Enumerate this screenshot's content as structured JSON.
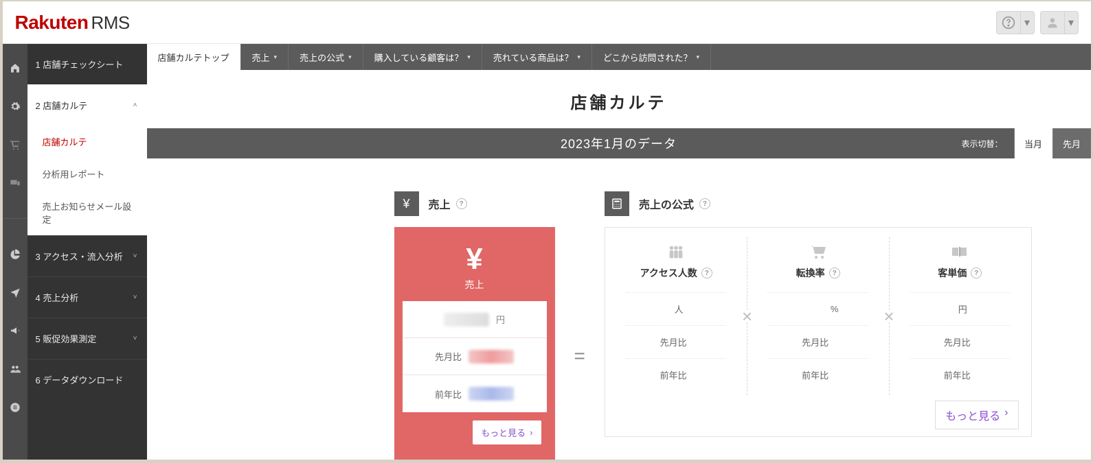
{
  "brand": {
    "name": "Rakuten",
    "suffix": "RMS"
  },
  "topbar": {
    "help": "help-icon",
    "user": "user-icon"
  },
  "rail_icons": [
    "home",
    "gear",
    "cart",
    "devices",
    "pie",
    "plane",
    "megaphone",
    "people",
    "list"
  ],
  "sidebar": {
    "items": [
      {
        "label": "1 店舗チェックシート",
        "expandable": false
      },
      {
        "label": "2 店舗カルテ",
        "expandable": true,
        "active": true,
        "children": [
          {
            "label": "店舗カルテ",
            "selected": true
          },
          {
            "label": "分析用レポート"
          },
          {
            "label": "売上お知らせメール設定"
          }
        ]
      },
      {
        "label": "3 アクセス・流入分析",
        "expandable": true
      },
      {
        "label": "4 売上分析",
        "expandable": true
      },
      {
        "label": "5 販促効果測定",
        "expandable": true
      },
      {
        "label": "6 データダウンロード",
        "expandable": false
      }
    ]
  },
  "tabs": [
    {
      "label": "店舗カルテトップ",
      "active": true
    },
    {
      "label": "売上",
      "caret": true
    },
    {
      "label": "売上の公式",
      "caret": true
    },
    {
      "label": "購入している顧客は？",
      "caret": true
    },
    {
      "label": "売れている商品は？",
      "caret": true
    },
    {
      "label": "どこから訪問された？",
      "caret": true
    }
  ],
  "page": {
    "title": "店舗カルテ",
    "period_text": "2023年1月のデータ",
    "switch_label": "表示切替：",
    "switch_options": [
      "当月",
      "先月"
    ],
    "switch_active": "当月"
  },
  "sales": {
    "heading": "売上",
    "hero_label": "売上",
    "value_unit": "円",
    "prev_month_label": "先月比",
    "prev_year_label": "前年比",
    "more": "もっと見る"
  },
  "formula": {
    "heading": "売上の公式",
    "metrics": [
      {
        "name": "アクセス人数",
        "unit": "人",
        "icon": "people"
      },
      {
        "name": "転換率",
        "unit": "%",
        "icon": "cart"
      },
      {
        "name": "客単価",
        "unit": "円",
        "icon": "books"
      }
    ],
    "prev_month_label": "先月比",
    "prev_year_label": "前年比",
    "more": "もっと見る"
  }
}
